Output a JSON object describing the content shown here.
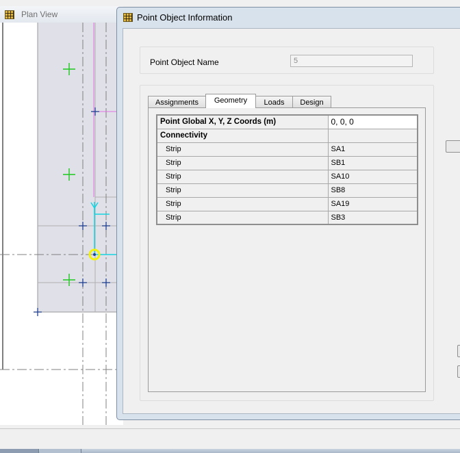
{
  "plan_view": {
    "title": "Plan View"
  },
  "dialog": {
    "title": "Point Object Information",
    "object_name": {
      "label": "Point Object Name",
      "value": "5"
    },
    "tabs": [
      {
        "label": "Assignments",
        "active": false
      },
      {
        "label": "Geometry",
        "active": true
      },
      {
        "label": "Loads",
        "active": false
      },
      {
        "label": "Design",
        "active": false
      }
    ],
    "geometry": {
      "coords_label": "Point Global X, Y, Z Coords  (m)",
      "coords_value": "0, 0, 0",
      "connectivity_label": "Connectivity",
      "connectivity": [
        {
          "type": "Strip",
          "name": "SA1"
        },
        {
          "type": "Strip",
          "name": "SB1"
        },
        {
          "type": "Strip",
          "name": "SA10"
        },
        {
          "type": "Strip",
          "name": "SB8"
        },
        {
          "type": "Strip",
          "name": "SA19"
        },
        {
          "type": "Strip",
          "name": "SB3"
        }
      ]
    }
  },
  "icons": {
    "app": "etabs-grid-icon"
  },
  "colors": {
    "dialog_frame": "#d8e2ec",
    "slab_fill": "#dfe0e8",
    "point_marker": "#1f3f8f",
    "green_marker": "#1ec81e",
    "selected_point": "#f2f20a",
    "strip_line": "#14d4e0",
    "grid_line_magenta": "#e070e0"
  }
}
